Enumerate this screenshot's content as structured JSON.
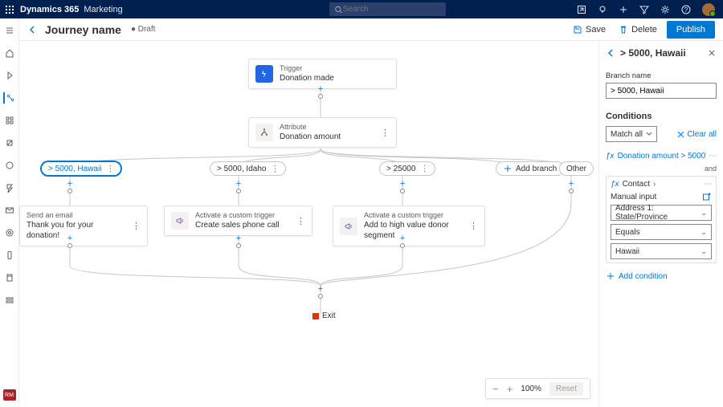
{
  "topbar": {
    "product": "Dynamics 365",
    "area": "Marketing",
    "search_placeholder": "Search"
  },
  "cmdbar": {
    "title": "Journey name",
    "status": "● Draft",
    "save": "Save",
    "delete": "Delete",
    "publish": "Publish"
  },
  "canvas": {
    "trigger": {
      "type": "Trigger",
      "title": "Donation made"
    },
    "attribute": {
      "type": "Attribute",
      "title": "Donation amount"
    },
    "branches": [
      {
        "label": "> 5000, Hawaii",
        "selected": true
      },
      {
        "label": "> 5000, Idaho"
      },
      {
        "label": "> 25000"
      }
    ],
    "add_branch": "Add branch",
    "other": "Other",
    "actions": [
      {
        "type": "Send an email",
        "title": "Thank you for your donation!"
      },
      {
        "type": "Activate a custom trigger",
        "title": "Create sales phone call"
      },
      {
        "type": "Activate a custom trigger",
        "title": "Add to high value donor segment"
      }
    ],
    "exit": "Exit"
  },
  "zoom": {
    "pct": "100%",
    "reset": "Reset"
  },
  "panel": {
    "title": "> 5000, Hawaii",
    "branch_name_label": "Branch name",
    "branch_name_value": "> 5000, Hawaii",
    "conditions_label": "Conditions",
    "match_all": "Match all",
    "clear_all": "Clear all",
    "condition1": "Donation amount > 5000",
    "and": "and",
    "contact": "Contact",
    "manual_input": "Manual input",
    "field": "Address 1: State/Province",
    "operator": "Equals",
    "value": "Hawaii",
    "add_condition": "Add condition"
  }
}
